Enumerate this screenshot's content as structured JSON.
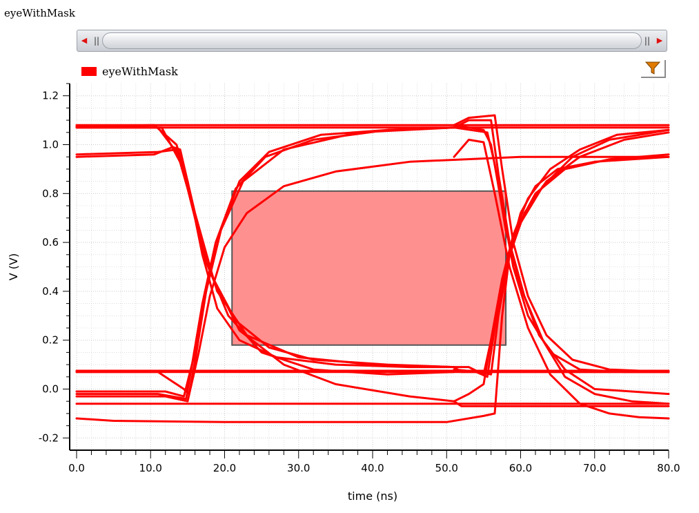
{
  "window": {
    "title": "eyeWithMask"
  },
  "scrollbar": {
    "left_arrow": "◀",
    "right_arrow": "▶",
    "grip": "||"
  },
  "legend": {
    "label": "eyeWithMask",
    "color": "#ff0000"
  },
  "filter": {
    "icon": "funnel-icon",
    "color": "#e07b00"
  },
  "chart_data": {
    "type": "line",
    "title": "",
    "xlabel": "time (ns)",
    "ylabel": "V (V)",
    "xlim": [
      0,
      80
    ],
    "ylim": [
      -0.25,
      1.25
    ],
    "xticks": [
      0,
      10,
      20,
      30,
      40,
      50,
      60,
      70,
      80
    ],
    "xtick_labels": [
      "0.0",
      "10.0",
      "20.0",
      "30.0",
      "40.0",
      "50.0",
      "60.0",
      "70.0",
      "80.0"
    ],
    "yticks": [
      -0.2,
      0.0,
      0.2,
      0.4,
      0.6,
      0.8,
      1.0,
      1.2
    ],
    "ytick_labels": [
      "-0.2",
      "0.0",
      "0.2",
      "0.4",
      "0.6",
      "0.8",
      "1.0",
      "1.2"
    ],
    "grid": true,
    "line_color": "#ff0000",
    "mask": {
      "x": [
        21,
        58
      ],
      "y": [
        0.18,
        0.81
      ],
      "fill": "#ff9090",
      "stroke": "#555555"
    },
    "series": [
      {
        "points": [
          [
            0,
            1.08
          ],
          [
            80,
            1.08
          ]
        ]
      },
      {
        "points": [
          [
            0,
            1.07
          ],
          [
            80,
            1.07
          ]
        ]
      },
      {
        "points": [
          [
            0,
            1.075
          ],
          [
            10.5,
            1.08
          ],
          [
            12,
            1.04
          ],
          [
            13.5,
            1.0
          ],
          [
            15,
            0.85
          ],
          [
            17,
            0.55
          ],
          [
            19,
            0.33
          ],
          [
            22,
            0.2
          ],
          [
            27,
            0.13
          ],
          [
            35,
            0.1
          ],
          [
            45,
            0.09
          ],
          [
            51,
            0.09
          ],
          [
            52,
            0.07
          ],
          [
            80,
            0.07
          ]
        ]
      },
      {
        "points": [
          [
            0,
            1.075
          ],
          [
            11,
            1.07
          ],
          [
            14,
            0.95
          ],
          [
            16,
            0.7
          ],
          [
            18.5,
            0.45
          ],
          [
            21.5,
            0.28
          ],
          [
            26,
            0.17
          ],
          [
            32,
            0.12
          ],
          [
            42,
            0.1
          ],
          [
            51,
            0.09
          ]
        ]
      },
      {
        "points": [
          [
            0,
            1.07
          ],
          [
            11.5,
            1.07
          ],
          [
            14.5,
            0.9
          ],
          [
            16.5,
            0.65
          ],
          [
            19,
            0.4
          ],
          [
            23,
            0.22
          ],
          [
            30,
            0.13
          ],
          [
            40,
            0.1
          ],
          [
            51,
            0.09
          ]
        ]
      },
      {
        "points": [
          [
            0,
            0.95
          ],
          [
            10.5,
            0.96
          ],
          [
            13,
            0.99
          ],
          [
            14,
            0.98
          ],
          [
            16,
            0.72
          ],
          [
            18.5,
            0.45
          ],
          [
            22,
            0.24
          ],
          [
            28,
            0.1
          ],
          [
            35,
            0.02
          ],
          [
            45,
            -0.03
          ],
          [
            51,
            -0.05
          ],
          [
            52,
            -0.07
          ],
          [
            80,
            -0.07
          ]
        ]
      },
      {
        "points": [
          [
            0,
            0.96
          ],
          [
            11,
            0.97
          ],
          [
            13.5,
            0.98
          ],
          [
            15,
            0.82
          ],
          [
            17.5,
            0.52
          ],
          [
            20.5,
            0.3
          ],
          [
            25,
            0.15
          ],
          [
            32,
            0.08
          ],
          [
            42,
            0.06
          ],
          [
            51,
            0.07
          ]
        ]
      },
      {
        "points": [
          [
            0,
            0.07
          ],
          [
            80,
            0.07
          ]
        ]
      },
      {
        "points": [
          [
            0,
            0.075
          ],
          [
            80,
            0.075
          ]
        ]
      },
      {
        "points": [
          [
            0,
            0.07
          ],
          [
            11,
            0.07
          ],
          [
            14.5,
            0.0
          ],
          [
            15.2,
            -0.02
          ],
          [
            16.2,
            0.15
          ],
          [
            17.5,
            0.4
          ],
          [
            19.5,
            0.65
          ],
          [
            22,
            0.85
          ],
          [
            26,
            0.97
          ],
          [
            33,
            1.04
          ],
          [
            42,
            1.06
          ],
          [
            51,
            1.07
          ]
        ]
      },
      {
        "points": [
          [
            0,
            -0.02
          ],
          [
            11,
            -0.02
          ],
          [
            14.8,
            -0.04
          ],
          [
            15.6,
            0.1
          ],
          [
            17,
            0.35
          ],
          [
            18.8,
            0.6
          ],
          [
            21.5,
            0.82
          ],
          [
            25.5,
            0.95
          ],
          [
            32,
            1.02
          ],
          [
            42,
            1.06
          ],
          [
            51,
            1.07
          ]
        ]
      },
      {
        "points": [
          [
            0,
            -0.01
          ],
          [
            12,
            -0.01
          ],
          [
            14.5,
            -0.03
          ],
          [
            16,
            0.15
          ],
          [
            17.5,
            0.4
          ],
          [
            19.5,
            0.65
          ],
          [
            22.5,
            0.85
          ],
          [
            28,
            0.98
          ],
          [
            38,
            1.05
          ],
          [
            51,
            1.07
          ]
        ]
      },
      {
        "points": [
          [
            0,
            -0.03
          ],
          [
            12,
            -0.03
          ],
          [
            15,
            -0.05
          ],
          [
            16.5,
            0.15
          ],
          [
            18,
            0.38
          ],
          [
            20,
            0.58
          ],
          [
            23,
            0.72
          ],
          [
            28,
            0.83
          ],
          [
            35,
            0.89
          ],
          [
            45,
            0.93
          ],
          [
            60,
            0.95
          ],
          [
            80,
            0.95
          ]
        ]
      },
      {
        "points": [
          [
            0,
            -0.06
          ],
          [
            80,
            -0.06
          ]
        ]
      },
      {
        "points": [
          [
            0,
            -0.12
          ],
          [
            5,
            -0.13
          ],
          [
            20,
            -0.135
          ],
          [
            35,
            -0.135
          ],
          [
            50,
            -0.135
          ],
          [
            55,
            -0.11
          ],
          [
            56.5,
            -0.1
          ],
          [
            57.5,
            0.3
          ],
          [
            58.5,
            0.55
          ],
          [
            60,
            0.72
          ],
          [
            62,
            0.83
          ],
          [
            65,
            0.9
          ],
          [
            70,
            0.93
          ],
          [
            80,
            0.95
          ]
        ]
      },
      {
        "points": [
          [
            51,
            0.09
          ],
          [
            53,
            0.09
          ],
          [
            55,
            0.06
          ],
          [
            56,
            0.2
          ],
          [
            57.5,
            0.45
          ],
          [
            59,
            0.63
          ],
          [
            61,
            0.78
          ],
          [
            64,
            0.9
          ],
          [
            68,
            0.98
          ],
          [
            73,
            1.04
          ],
          [
            80,
            1.06
          ]
        ]
      },
      {
        "points": [
          [
            51,
            0.08
          ],
          [
            54,
            0.07
          ],
          [
            55.5,
            0.05
          ],
          [
            56.5,
            0.25
          ],
          [
            58,
            0.5
          ],
          [
            60,
            0.68
          ],
          [
            63,
            0.83
          ],
          [
            67,
            0.95
          ],
          [
            72,
            1.02
          ],
          [
            80,
            1.06
          ]
        ]
      },
      {
        "points": [
          [
            51,
            0.08
          ],
          [
            54.5,
            0.07
          ],
          [
            56,
            0.06
          ],
          [
            57,
            0.3
          ],
          [
            58.5,
            0.55
          ],
          [
            60.5,
            0.72
          ],
          [
            63.5,
            0.85
          ],
          [
            68,
            0.95
          ],
          [
            74,
            1.02
          ],
          [
            80,
            1.05
          ]
        ]
      },
      {
        "points": [
          [
            51,
            -0.05
          ],
          [
            53,
            -0.02
          ],
          [
            55,
            0.02
          ],
          [
            56,
            0.2
          ],
          [
            57.5,
            0.45
          ],
          [
            59.5,
            0.66
          ],
          [
            62,
            0.8
          ],
          [
            66,
            0.9
          ],
          [
            72,
            0.94
          ],
          [
            80,
            0.96
          ]
        ]
      },
      {
        "points": [
          [
            51,
            1.08
          ],
          [
            53,
            1.11
          ],
          [
            56.5,
            1.12
          ],
          [
            57.5,
            0.9
          ],
          [
            59,
            0.6
          ],
          [
            61,
            0.38
          ],
          [
            63.5,
            0.22
          ],
          [
            67,
            0.12
          ],
          [
            72,
            0.08
          ],
          [
            80,
            0.07
          ]
        ]
      },
      {
        "points": [
          [
            51,
            1.07
          ],
          [
            53,
            1.1
          ],
          [
            56,
            1.1
          ],
          [
            57,
            0.88
          ],
          [
            58.5,
            0.6
          ],
          [
            60.5,
            0.38
          ],
          [
            63,
            0.2
          ],
          [
            66,
            0.05
          ],
          [
            70,
            -0.02
          ],
          [
            75,
            -0.05
          ],
          [
            80,
            -0.06
          ]
        ]
      },
      {
        "points": [
          [
            51,
            1.08
          ],
          [
            55,
            1.06
          ],
          [
            56,
            1.0
          ],
          [
            57.5,
            0.75
          ],
          [
            59,
            0.5
          ],
          [
            61,
            0.3
          ],
          [
            64,
            0.15
          ],
          [
            68,
            0.08
          ],
          [
            74,
            0.07
          ],
          [
            80,
            0.07
          ]
        ]
      },
      {
        "points": [
          [
            51,
            1.07
          ],
          [
            55.5,
            1.05
          ],
          [
            56.5,
            0.92
          ],
          [
            58,
            0.65
          ],
          [
            60,
            0.42
          ],
          [
            62.5,
            0.22
          ],
          [
            66,
            0.08
          ],
          [
            70,
            0.0
          ],
          [
            75,
            -0.01
          ],
          [
            80,
            -0.02
          ]
        ]
      },
      {
        "points": [
          [
            51,
            0.95
          ],
          [
            53,
            1.02
          ],
          [
            55,
            1.01
          ],
          [
            56.5,
            0.8
          ],
          [
            58.5,
            0.5
          ],
          [
            61,
            0.25
          ],
          [
            64,
            0.06
          ],
          [
            68,
            -0.06
          ],
          [
            72,
            -0.1
          ],
          [
            76,
            -0.115
          ],
          [
            80,
            -0.12
          ]
        ]
      }
    ]
  }
}
